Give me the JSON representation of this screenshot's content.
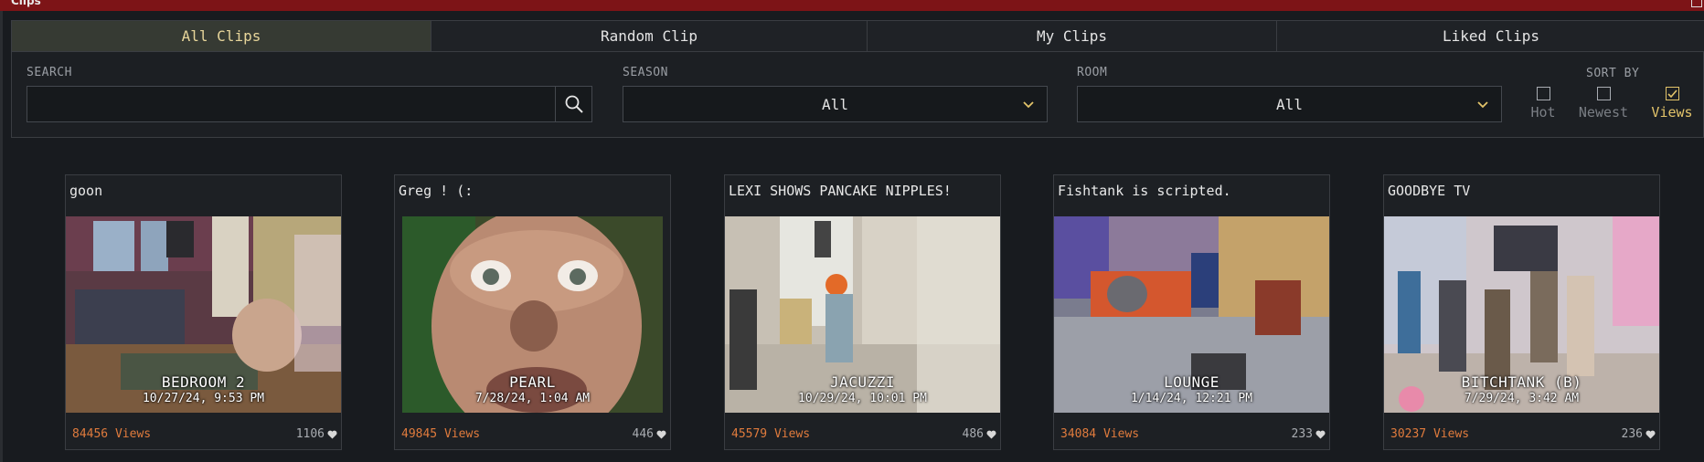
{
  "window": {
    "title": "Clips"
  },
  "tabs": [
    {
      "label": "All Clips",
      "active": true
    },
    {
      "label": "Random Clip",
      "active": false
    },
    {
      "label": "My Clips",
      "active": false
    },
    {
      "label": "Liked Clips",
      "active": false
    }
  ],
  "filters": {
    "search_label": "SEARCH",
    "search_value": "",
    "search_icon": "search-icon",
    "season_label": "SEASON",
    "season_value": "All",
    "room_label": "ROOM",
    "room_value": "All",
    "sort_label": "SORT BY",
    "sort_options": [
      {
        "label": "Hot",
        "checked": false
      },
      {
        "label": "Newest",
        "checked": false
      },
      {
        "label": "Views",
        "checked": true
      }
    ]
  },
  "colors": {
    "accent": "#e3c46a",
    "views": "#e07b3d",
    "titlebar": "#7d1417"
  },
  "clips": [
    {
      "title": "goon",
      "room": "BEDROOM 2",
      "date": "10/27/24, 9:53 PM",
      "views": "84456 Views",
      "likes": "1106"
    },
    {
      "title": "Greg ! (:",
      "room": "PEARL",
      "date": "7/28/24, 1:04 AM",
      "views": "49845 Views",
      "likes": "446"
    },
    {
      "title": "LEXI SHOWS PANCAKE NIPPLES!",
      "room": "JACUZZI",
      "date": "10/29/24, 10:01 PM",
      "views": "45579 Views",
      "likes": "486"
    },
    {
      "title": "Fishtank is scripted.",
      "room": "LOUNGE",
      "date": "1/14/24, 12:21 PM",
      "views": "34084 Views",
      "likes": "233"
    },
    {
      "title": "GOODBYE TV",
      "room": "BITCHTANK (B)",
      "date": "7/29/24, 3:42 AM",
      "views": "30237 Views",
      "likes": "236"
    }
  ]
}
